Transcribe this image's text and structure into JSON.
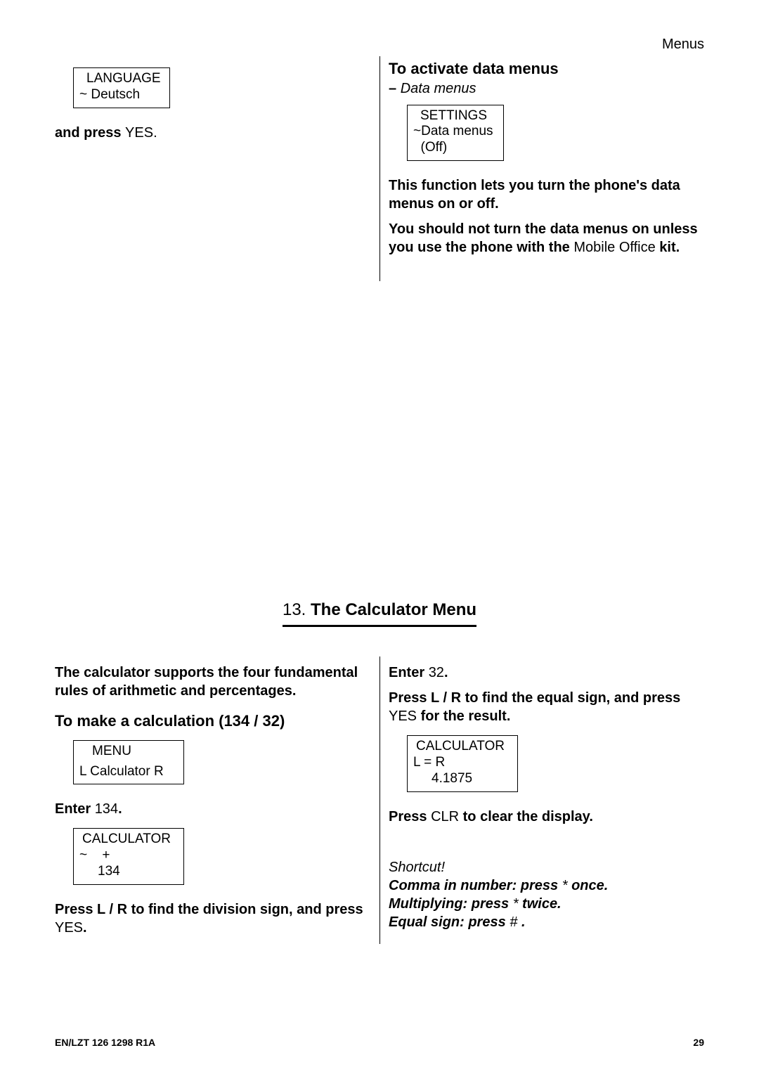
{
  "header": {
    "section": "Menus"
  },
  "topLeft": {
    "box": {
      "title": "LANGUAGE",
      "line2": "~ Deutsch"
    },
    "and_press_prefix": "and press ",
    "and_press_key": "YES",
    "and_press_suffix": "."
  },
  "topRight": {
    "heading": "To activate data menus",
    "sub_dash": "– ",
    "sub_text": "Data menus",
    "box": {
      "title": "SETTINGS",
      "line2": "~Data menus",
      "line3": "  (Off)"
    },
    "p1": "This function lets you turn the phone's data menus on or off.",
    "p2_a": "You should not turn the data menus on unless you use the phone with the ",
    "p2_b": "Mobile Office",
    "p2_c": " kit."
  },
  "section13": {
    "number": "13. ",
    "title": "The Calculator Menu"
  },
  "calcLeft": {
    "intro": "The calculator supports the four fundamental rules of arithmetic and percentages.",
    "heading": "To make a calculation (134 / 32)",
    "menuBox": {
      "title": "MENU",
      "l": "L",
      "mid": "Calculator",
      "r": "R"
    },
    "enter134_prefix": "Enter ",
    "enter134_val": "134",
    "enter134_suffix": ".",
    "calcBox1": {
      "title": "CALCULATOR",
      "line2a": "~",
      "line2b": "+",
      "line3": "134"
    },
    "division_a": "Press L / R to find the division sign, and press ",
    "division_key": "YES",
    "division_b": "."
  },
  "calcRight": {
    "enter32_prefix": "Enter ",
    "enter32_val": "32",
    "enter32_suffix": ".",
    "equal_a": "Press L / R to find the equal sign, and press ",
    "equal_key": "YES",
    "equal_b": " for the result.",
    "calcBox2": {
      "title": "CALCULATOR",
      "l": "L",
      "mid": "=",
      "r": "R",
      "line3": "4.1875"
    },
    "clear_a": "Press ",
    "clear_key": "CLR",
    "clear_b": " to clear the display.",
    "shortcut_label": "Shortcut!",
    "s1_a": "Comma in number: press ",
    "s1_b": "*",
    "s1_c": " once.",
    "s2_a": "Multiplying: press ",
    "s2_b": "*",
    "s2_c": " twice.",
    "s3_a": "Equal sign: press ",
    "s3_b": "#",
    "s3_c": " ."
  },
  "footer": {
    "doc": "EN/LZT 126 1298  R1A",
    "page": "29"
  }
}
